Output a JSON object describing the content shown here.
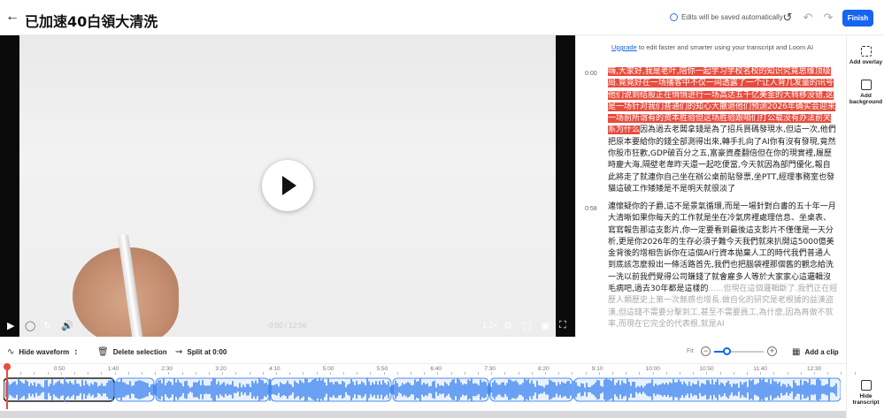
{
  "header": {
    "title": "已加速40白領大清洗",
    "saved_text": "Edits will be saved automatically",
    "finish_label": "Finish"
  },
  "video": {
    "time": "0:00 / 12:56",
    "speed": "1.2×"
  },
  "transcript": {
    "upgrade_link": "Upgrade",
    "upgrade_rest": " to edit faster and smarter using your transcript and Loom AI",
    "blocks": [
      {
        "time": "0:00",
        "highlighted": "嗨,大家好,我是老叶,陪你一起学习学校名校的知识究竟思维顶级局.竟竟好在一场播客中不仅一间透露了一个让人背几发量的讯号他们说到结股正在悄悄进行一场高达五千亿美金的大转移没错,这是一场针对我们普通们的知心大撤退他们预测2026年确实会迎来一场前所谓有的资本胜验但这场胜验跟咱们打公载没有办法前关系为什么",
        "normal": "因為過去老闆拿錢是為了招兵買碼發現水,但這一次,他們把原本要給你的錢全部測得出來,轉手扎向了AI你有沒有發現,竟然你股市狂歡,GDP破百分之五,富豪資產翻倍但在你的現實裡,履歷時慶大海,隔壁老韋昨天還一起吃便當,今天就因為部門優化,報自此將走了就連你自己坐在辦公桌前貼發票,坐PTT,經理事務室也發貓這破工作矮矮是不是明天就很淡了"
      },
      {
        "time": "0:58",
        "normal": "連懷疑你的子爵,這不是景氣循環,而是一場針對白書的五十年一月大清晰如果你每天的工作就是坐在冷氣房裡處理信息、坐桌表、寫寫報告那這支影片,你一定要看到最後這支影片不僅僅是一天分析,更是你2026年的生存必須子難今天我們就來扒開這5000億美金背後的增相告訴你在這個AI行資本拋棄人工的時代我們普通人到底該怎麼殺出一條活路首先,我們也把腦袋裡那個舊的觀念給洗一洗以前我們覺得公司賺錢了就會雇多人等於大家家心這邏輯沒毛病吧,過去30年都是這樣的",
        "faded": "......但現在這個邏輯斷了.我們正在經歷人類歷史上第一次無感也增長.做自化的研究是老根據的益漢盜漢,但這錢不需要分擊到工,甚至不需要員工,為什麼,因為再做不就率,而現在它完全的代表根,就是AI"
      }
    ]
  },
  "sidebar": {
    "overlay": "Add overlay",
    "background": "Add background",
    "hide_transcript": "Hide transcript"
  },
  "toolbar": {
    "hide_waveform": "Hide waveform",
    "delete_selection": "Delete selection",
    "split_at": "Split at 0:00",
    "fit": "Fit",
    "add_clip": "Add a clip",
    "zoom_level": 0.25
  },
  "timeline": {
    "ticks": [
      "0",
      "0:50",
      "1:40",
      "2:30",
      "3:20",
      "4:10",
      "5:00",
      "5:50",
      "6:40",
      "7:30",
      "8:20",
      "9:10",
      "10:00",
      "10:50",
      "11:40",
      "12:30"
    ]
  },
  "colors": {
    "accent": "#1664f2",
    "highlight": "#e84c3d",
    "waveform": "#4a8df0"
  }
}
